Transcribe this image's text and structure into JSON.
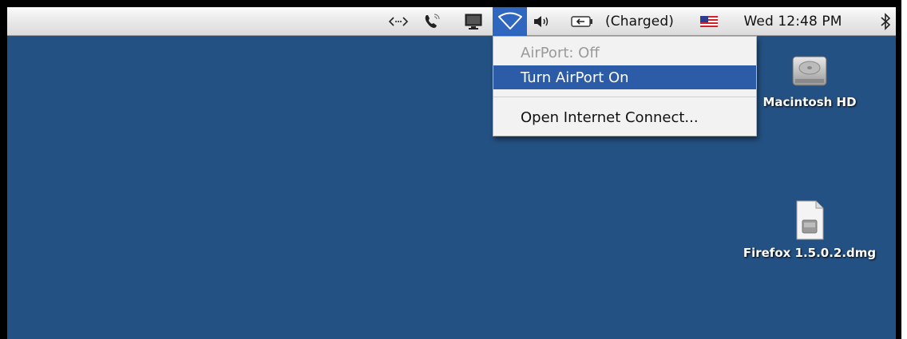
{
  "menubar": {
    "items": [
      {
        "name": "network-sync-icon",
        "glyph": "<·>"
      },
      {
        "name": "phone-modem-icon",
        "glyph": "✆"
      },
      {
        "name": "display-icon",
        "glyph": "▣"
      },
      {
        "name": "airport-wifi-icon",
        "glyph": "wifi"
      },
      {
        "name": "volume-icon",
        "glyph": "◀)"
      },
      {
        "name": "battery-icon",
        "glyph": "battery"
      }
    ],
    "battery_status": "(Charged)",
    "input_flag": "us-flag-icon",
    "clock": "Wed 12:48 PM",
    "bluetooth_glyph": "bluetooth-icon"
  },
  "airport_menu": {
    "status": "AirPort: Off",
    "turn_on": "Turn AirPort On",
    "open_internet_connect": "Open Internet Connect..."
  },
  "desktop": {
    "background_color": "#245183",
    "icons": [
      {
        "label": "Macintosh HD",
        "icon": "hard-drive-icon"
      },
      {
        "label": "Firefox 1.5.0.2.dmg",
        "icon": "disk-image-icon"
      }
    ]
  },
  "colors": {
    "selection": "#2c5ba8",
    "menubar_active": "#2f66c0"
  }
}
